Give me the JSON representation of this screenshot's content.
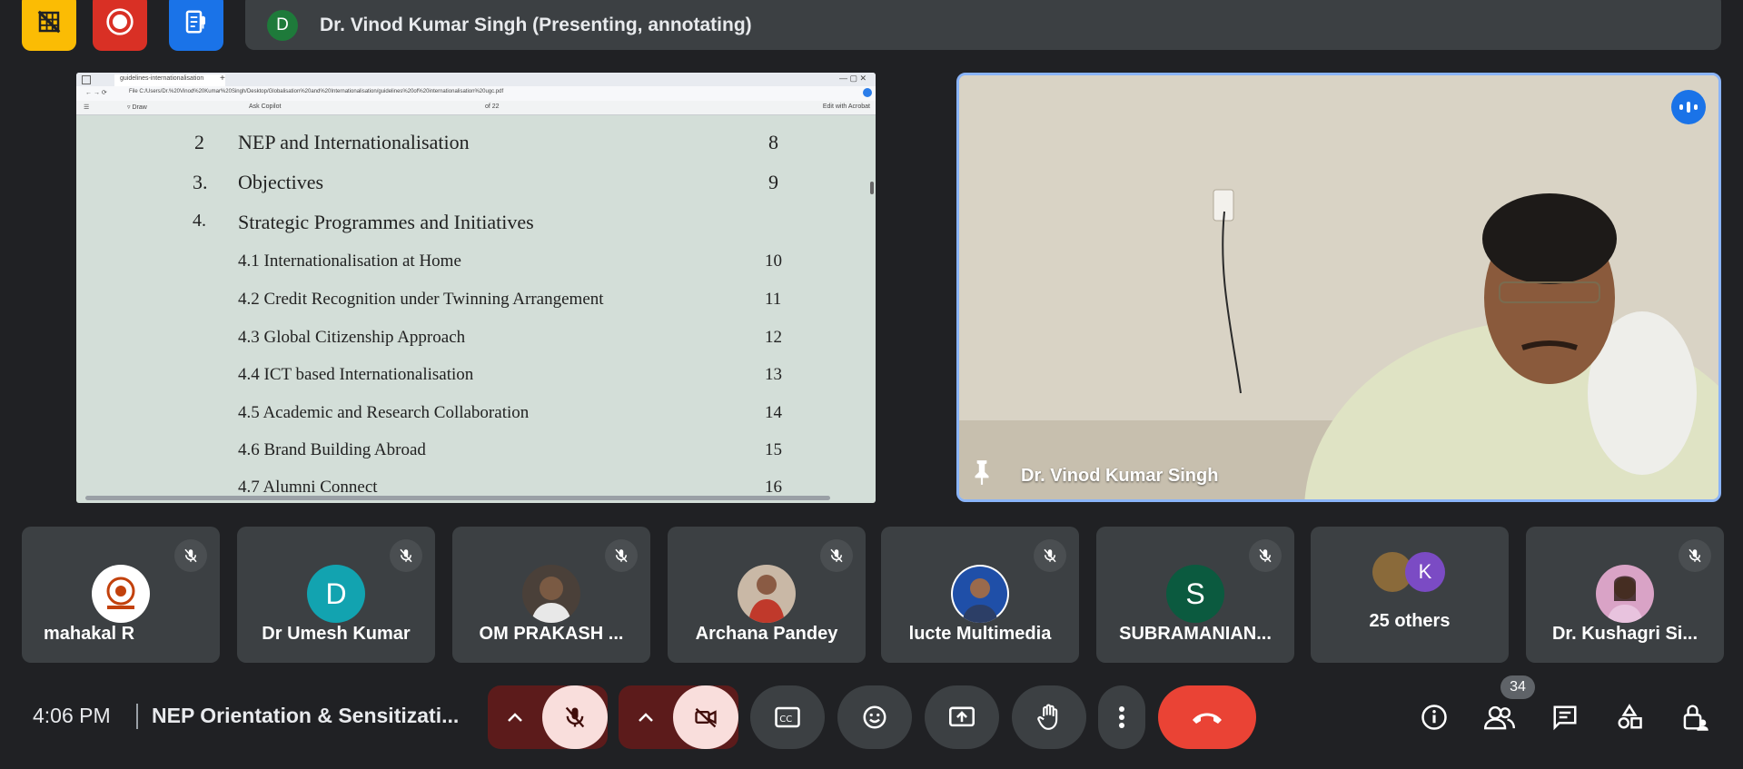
{
  "presenter_bar": {
    "avatar_initial": "D",
    "text": "Dr. Vinod Kumar Singh (Presenting, annotating)"
  },
  "shared_screen": {
    "tab_title": "guidelines-internationalisation",
    "url": "File  C:/Users/Dr.%20Vinod%20Kumar%20Singh/Desktop/Globalisation%20and%20Internationalisation/guidelines%20of%20internationalisation%20ugc.pdf",
    "toolbar": {
      "draw": "Draw",
      "ask_copilot": "Ask Copilot",
      "page": "of 22",
      "edit_acrobat": "Edit with Acrobat"
    },
    "toc": [
      {
        "num": "2",
        "title": "NEP and Internationalisation",
        "page": "8"
      },
      {
        "num": "3.",
        "title": "Objectives",
        "page": "9"
      },
      {
        "num": "4.",
        "title": "Strategic Programmes and Initiatives",
        "page": ""
      }
    ],
    "subsections": [
      {
        "title": "4.1 Internationalisation at Home",
        "page": "10"
      },
      {
        "title": "4.2 Credit Recognition under Twinning Arrangement",
        "page": "11"
      },
      {
        "title": "4.3 Global Citizenship Approach",
        "page": "12"
      },
      {
        "title": "4.4 ICT based Internationalisation",
        "page": "13"
      },
      {
        "title": "4.5 Academic and Research Collaboration",
        "page": "14"
      },
      {
        "title": "4.6 Brand Building Abroad",
        "page": "15"
      },
      {
        "title": "4.7 Alumni Connect",
        "page": "16"
      }
    ]
  },
  "presenter_video": {
    "name": "Dr. Vinod Kumar Singh"
  },
  "participants": [
    {
      "name": "mahakal R",
      "initial": "",
      "color": "#ffffff"
    },
    {
      "name": "Dr Umesh Kumar",
      "initial": "D",
      "color": "#12a3b0"
    },
    {
      "name": "OM PRAKASH ...",
      "initial": "",
      "color": "#6b5a4a"
    },
    {
      "name": "Archana Pandey",
      "initial": "",
      "color": "#b86a5a"
    },
    {
      "name": "lucte Multimedia",
      "initial": "",
      "color": "#2f5fb0"
    },
    {
      "name": "SUBRAMANIAN...",
      "initial": "S",
      "color": "#0b5a3f"
    },
    {
      "name": "25 others",
      "initial": "K",
      "color": "#7b4bc4"
    },
    {
      "name": "Dr. Kushagri Si...",
      "initial": "",
      "color": "#c07aa8"
    }
  ],
  "bottom_bar": {
    "time": "4:06 PM",
    "meeting_title": "NEP Orientation & Sensitizati...",
    "participant_count": "34"
  },
  "colors": {
    "background": "#202124",
    "tile": "#3c4043",
    "accent_blue": "#8ab4f8",
    "end_call": "#ea4335",
    "yellow_btn": "#fbbc04",
    "record_red": "#d93025",
    "blue_btn": "#1a73e8"
  }
}
